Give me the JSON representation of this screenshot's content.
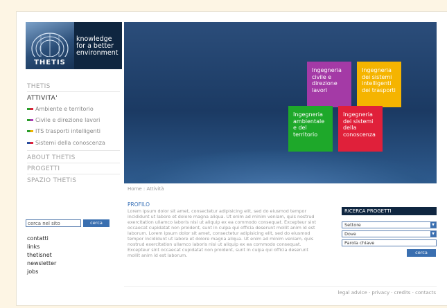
{
  "logo": {
    "word": "THETIS",
    "tagline_1": "knowledge",
    "tagline_2": "for a better",
    "tagline_3": "environment"
  },
  "nav": {
    "thetis": "THETIS",
    "attivita": "ATTIVITA'",
    "sub": [
      {
        "label": "Ambiente e territorio",
        "c1": "#2a9d2a",
        "c2": "#e0203a"
      },
      {
        "label": "Civile e direzione lavori",
        "c1": "#2a9d2a",
        "c2": "#b03ab8"
      },
      {
        "label": "ITS trasporti intelligenti",
        "c1": "#2a9d2a",
        "c2": "#f0b400"
      },
      {
        "label": "Sistemi della conoscenza",
        "c1": "#2a4d9d",
        "c2": "#e0203a"
      }
    ],
    "about": "ABOUT THETIS",
    "progetti": "PROGETTI",
    "spazio": "SPAZIO THETIS"
  },
  "tiles": [
    {
      "label": "Ingegneria civile e direzione lavori",
      "color": "#a43aa6"
    },
    {
      "label": "Ingegneria dei sistemi intelligenti dei trasporti",
      "color": "#f5b400"
    },
    {
      "label": "Ingegneria ambientale e del territorio",
      "color": "#1ea82a"
    },
    {
      "label": "Ingegneria dei sistemi della conoscenza",
      "color": "#e0203a"
    }
  ],
  "breadcrumb": "Home : Attività",
  "profile": {
    "title": "PROFILO",
    "body": "Lorem ipsum dolor sit amet, consectetur adipisicing elit, sed do eiusmod tempor incididunt ut labore et dolore magna aliqua. Ut enim ad minim veniam, quis nostrud exercitation ullamco laboris nisi ut aliquip ex ea commodo consequat. Excepteur sint occaecat cupidatat non proident, sunt in culpa qui officia deserunt mollit anim id est laborum. Lorem ipsum dolor sit amet, consectetur adipisicing elit, sed do eiusmod tempor incididunt ut labore et dolore magna aliqua. Ut enim ad minim veniam, quis nostrud exercitation ullamco laboris nisi ut aliquip ex ea commodo consequat. Excepteur sint occaecat cupidatat non proident, sunt in culpa qui officia deserunt mollit anim id est laborum."
  },
  "site_search": {
    "value": "cerca nel sito",
    "button": "cerca"
  },
  "footer_links": [
    "contatti",
    "links",
    "thetisnet",
    "newsletter",
    "jobs"
  ],
  "ricerca": {
    "title": "RICERCA PROGETTI",
    "settore": "Settore",
    "dove": "Dove",
    "keyword": "Parola chiave",
    "button": "cerca"
  },
  "footer": {
    "legal": "legal advice",
    "privacy": "privacy",
    "credits": "credits",
    "contacts": "contacts"
  }
}
